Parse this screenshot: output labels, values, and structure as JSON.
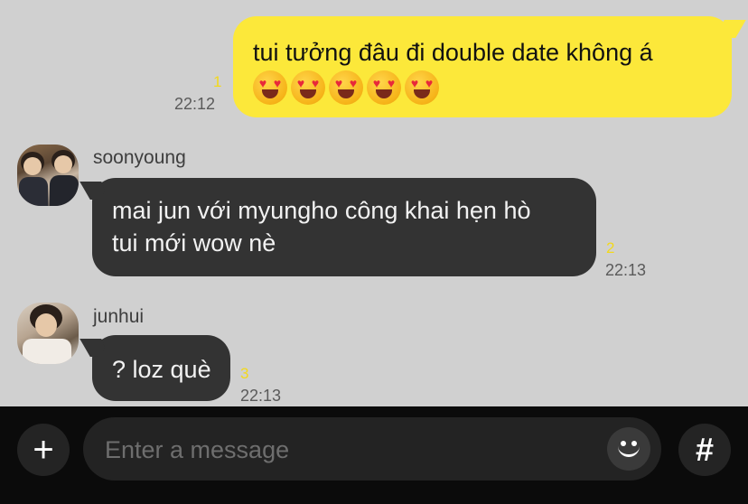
{
  "messages": {
    "outgoing": {
      "text": "tui tưởng đâu đi double date không á",
      "emoji": [
        "heart-eyes",
        "heart-eyes",
        "heart-eyes",
        "heart-eyes",
        "heart-eyes"
      ],
      "unread": "1",
      "time": "22:12"
    },
    "incoming_1": {
      "sender": "soonyoung",
      "line1": "mai jun với myungho công khai hẹn hò",
      "line2": "tui mới wow nè",
      "unread": "2",
      "time": "22:13"
    },
    "incoming_2": {
      "sender": "junhui",
      "text": "? loz què",
      "unread": "3",
      "time": "22:13"
    }
  },
  "input_bar": {
    "plus_glyph": "+",
    "placeholder": "Enter a message",
    "hash_glyph": "#"
  },
  "colors": {
    "chat_background": "#d0d0d0",
    "outgoing_bubble": "#fce83a",
    "incoming_bubble": "#333333",
    "unread_count": "#f3d91c",
    "input_bar": "#0b0b0b"
  }
}
